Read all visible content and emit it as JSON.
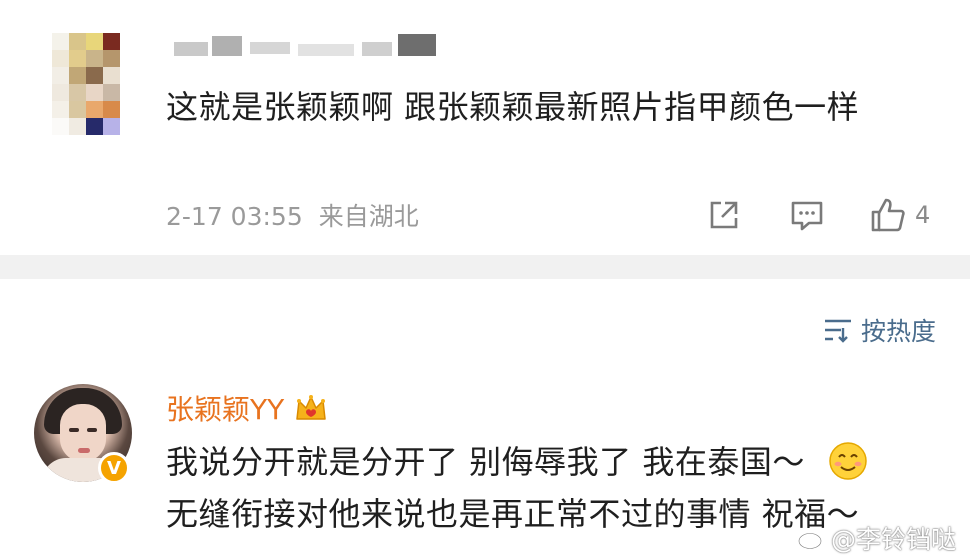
{
  "comment_top": {
    "text": "这就是张颖颖啊 跟张颖颖最新照片指甲颜色一样",
    "timestamp": "2-17 03:55",
    "location": "来自湖北",
    "like_count": "4"
  },
  "sort": {
    "label": "按热度"
  },
  "comment_main": {
    "username": "张颖颖YY",
    "verified_badge": "V",
    "text_line1": "我说分开就是分开了 别侮辱我了 我在泰国～",
    "text_line2": "无缝衔接对他来说也是再正常不过的事情 祝福～"
  },
  "watermark": {
    "text": "@李铃铛哒"
  },
  "icons": {
    "share": "share-icon",
    "comment": "comment-icon",
    "like": "thumbs-up-icon",
    "sort": "sort-lines-icon",
    "crown": "crown-icon",
    "emoji": "smile-emoji-icon",
    "weibo": "weibo-logo-icon"
  },
  "colors": {
    "username": "#e8731f",
    "sort_label": "#4a6c8c",
    "meta_text": "#9a9a9a",
    "divider": "#f1f1f1",
    "badge": "#f5a300"
  }
}
